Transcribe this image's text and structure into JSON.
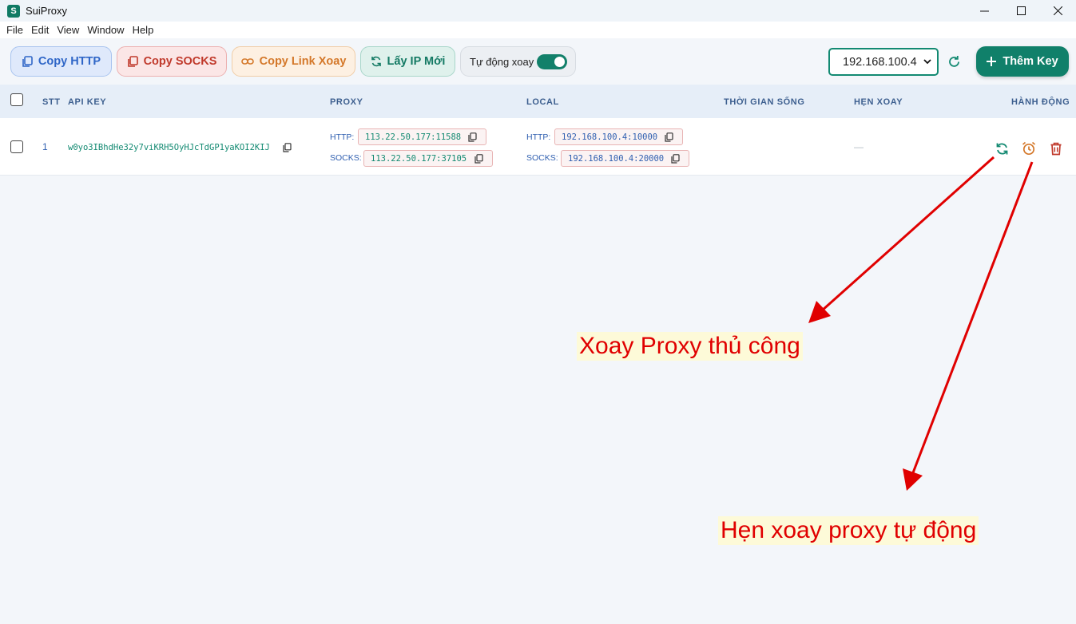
{
  "window": {
    "title": "SuiProxy",
    "icon_letter": "S"
  },
  "menu": [
    "File",
    "Edit",
    "View",
    "Window",
    "Help"
  ],
  "toolbar": {
    "copy_http": "Copy HTTP",
    "copy_socks": "Copy SOCKS",
    "copy_link": "Copy Link Xoay",
    "get_new_ip": "Lấy IP Mới",
    "auto_rotate_label": "Tự động xoay",
    "auto_rotate_on": true,
    "ip_select_value": "192.168.100.4",
    "add_key": "Thêm Key"
  },
  "table": {
    "headers": {
      "stt": "STT",
      "api_key": "API KEY",
      "proxy": "PROXY",
      "local": "LOCAL",
      "lifetime": "THỜI GIAN SỐNG",
      "schedule": "HẸN XOAY",
      "actions": "HÀNH ĐỘNG"
    },
    "rows": [
      {
        "stt": "1",
        "api_key": "w0yo3IBhdHe32y7viKRH5OyHJcTdGP1yaKOI2KIJ",
        "proxy_http_label": "HTTP:",
        "proxy_http": "113.22.50.177:11588",
        "proxy_socks_label": "SOCKS:",
        "proxy_socks": "113.22.50.177:37105",
        "local_http_label": "HTTP:",
        "local_http": "192.168.100.4:10000",
        "local_socks_label": "SOCKS:",
        "local_socks": "192.168.100.4:20000",
        "lifetime": "",
        "schedule": "—"
      }
    ]
  },
  "annotations": {
    "manual_rotate": "Xoay Proxy thủ công",
    "scheduled_rotate": "Hẹn xoay proxy tự động"
  },
  "colors": {
    "accent": "#10806a",
    "annotation_red": "#e00000",
    "annotation_bg": "#fdfad8"
  }
}
